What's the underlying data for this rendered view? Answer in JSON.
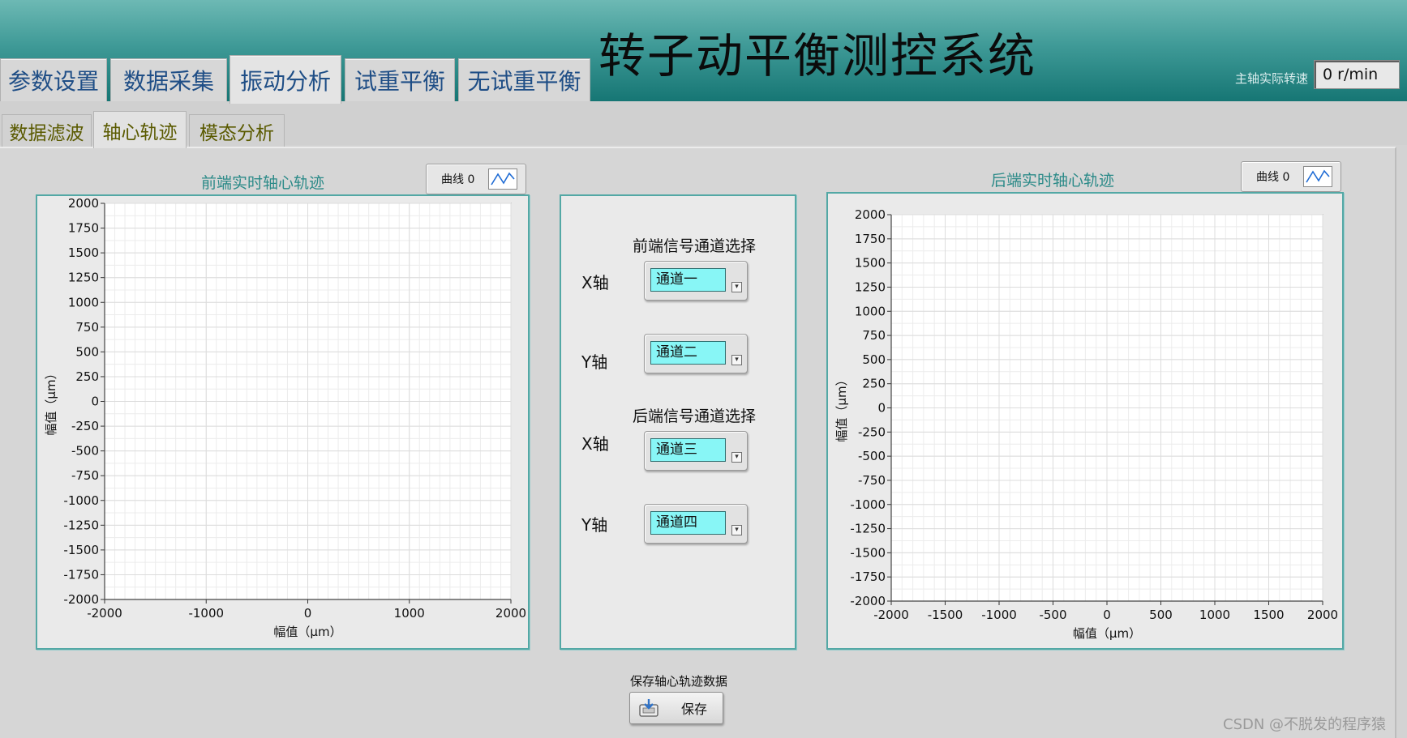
{
  "app": {
    "title": "转子动平衡测控系统",
    "spindle_speed_label": "主轴实际转速",
    "spindle_speed_value": "0 r/min"
  },
  "main_tabs": [
    {
      "label": "参数设置",
      "active": false
    },
    {
      "label": "数据采集",
      "active": false
    },
    {
      "label": "振动分析",
      "active": true
    },
    {
      "label": "试重平衡",
      "active": false
    },
    {
      "label": "无试重平衡",
      "active": false
    }
  ],
  "sub_tabs": [
    {
      "label": "数据滤波",
      "active": false
    },
    {
      "label": "轴心轨迹",
      "active": true
    },
    {
      "label": "模态分析",
      "active": false
    }
  ],
  "front_chart": {
    "title": "前端实时轴心轨迹",
    "legend": "曲线 0",
    "xlabel": "幅值（μm）",
    "ylabel": "幅值（μm）",
    "xticks": [
      "-2000",
      "-1000",
      "0",
      "1000",
      "2000"
    ],
    "yticks": [
      "2000",
      "1750",
      "1500",
      "1250",
      "1000",
      "750",
      "500",
      "250",
      "0",
      "-250",
      "-500",
      "-750",
      "-1000",
      "-1250",
      "-1500",
      "-1750",
      "-2000"
    ]
  },
  "rear_chart": {
    "title": "后端实时轴心轨迹",
    "legend": "曲线 0",
    "xlabel": "幅值（μm）",
    "ylabel": "幅值（μm）",
    "xticks": [
      "-2000",
      "-1500",
      "-1000",
      "-500",
      "0",
      "500",
      "1000",
      "1500",
      "2000"
    ],
    "yticks": [
      "2000",
      "1750",
      "1500",
      "1250",
      "1000",
      "750",
      "500",
      "250",
      "0",
      "-250",
      "-500",
      "-750",
      "-1000",
      "-1250",
      "-1500",
      "-1750",
      "-2000"
    ]
  },
  "chart_data": [
    {
      "type": "scatter",
      "title": "前端实时轴心轨迹",
      "xlabel": "幅值（μm）",
      "ylabel": "幅值（μm）",
      "xlim": [
        -2000,
        2000
      ],
      "ylim": [
        -2000,
        2000
      ],
      "grid": true,
      "legend": "top-right",
      "series": [
        {
          "name": "曲线 0",
          "x": [],
          "y": []
        }
      ]
    },
    {
      "type": "scatter",
      "title": "后端实时轴心轨迹",
      "xlabel": "幅值（μm）",
      "ylabel": "幅值（μm）",
      "xlim": [
        -2000,
        2000
      ],
      "ylim": [
        -2000,
        2000
      ],
      "grid": true,
      "legend": "top-right",
      "series": [
        {
          "name": "曲线 0",
          "x": [],
          "y": []
        }
      ]
    }
  ],
  "channel_select": {
    "front_title": "前端信号通道选择",
    "rear_title": "后端信号通道选择",
    "x_axis_label": "X轴",
    "y_axis_label": "Y轴",
    "front_x": "通道一",
    "front_y": "通道二",
    "rear_x": "通道三",
    "rear_y": "通道四"
  },
  "save": {
    "caption": "保存轴心轨迹数据",
    "button_label": "保存"
  },
  "watermark": "CSDN @不脱发的程序猿",
  "colors": {
    "header_top": "#6db9b4",
    "header_bottom": "#167674",
    "panel_border": "#53a8a5",
    "ring_fill": "#88f6f6",
    "chart_title": "#2b8a88"
  }
}
